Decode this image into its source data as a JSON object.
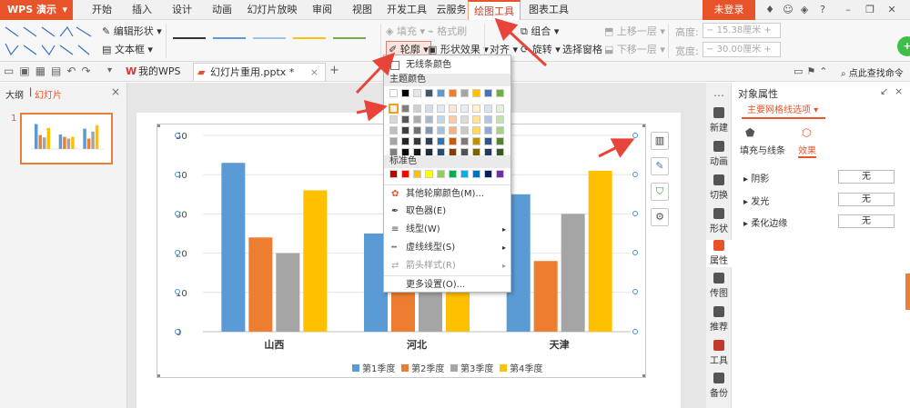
{
  "titlebar": {
    "app_name": "WPS 演示",
    "tabs": [
      "开始",
      "插入",
      "设计",
      "动画",
      "幻灯片放映",
      "审阅",
      "视图",
      "开发工具",
      "云服务",
      "绘图工具",
      "图表工具"
    ],
    "active_tab": "绘图工具",
    "login_label": "未登录",
    "icons": [
      "shirt-icon",
      "user-icon",
      "help-icon",
      "minimize-icon",
      "restore-icon",
      "close-icon"
    ]
  },
  "ribbon": {
    "edit_shape_label": "编辑形状",
    "textbox_label": "文本框",
    "fill_label": "填充",
    "format_brush_label": "格式刷",
    "outline_label": "轮廓",
    "shape_effect_label": "形状效果",
    "align_label": "对齐",
    "group_label": "组合",
    "rotate_label": "旋转",
    "selection_pane_label": "选择窗格",
    "bring_forward_label": "上移一层",
    "send_backward_label": "下移一层",
    "height_label": "高度:",
    "height_value": "15.38厘米",
    "width_label": "宽度:",
    "width_value": "30.00厘米",
    "line_style_colors": [
      "#333333",
      "#5b9bd5",
      "#9dc3e6",
      "#ffc000",
      "#70ad47"
    ]
  },
  "docbar": {
    "tabs": [
      {
        "label": "我的WPS"
      },
      {
        "label": "幻灯片重用.pptx *"
      }
    ],
    "search_label": "点此查找命令"
  },
  "leftpanel": {
    "tab_outline": "大纲",
    "tab_slides": "幻灯片",
    "slide_number": "1"
  },
  "dropdown": {
    "no_line_label": "无线条颜色",
    "theme_colors_header": "主题颜色",
    "standard_colors_header": "标准色",
    "theme_top_row": [
      "#ffffff",
      "#000000",
      "#e7e6e6",
      "#44546a",
      "#5b9bd5",
      "#ed7d31",
      "#a5a5a5",
      "#ffc000",
      "#4472c4",
      "#70ad47"
    ],
    "theme_shades": [
      [
        "#f2f2f2",
        "#7f7f7f",
        "#d0cece",
        "#d6dce4",
        "#deebf6",
        "#fbe5d5",
        "#ededed",
        "#fff2cc",
        "#d9e2f3",
        "#e2efd9"
      ],
      [
        "#d8d8d8",
        "#595959",
        "#aeabab",
        "#adb9ca",
        "#bdd7ee",
        "#f7cbac",
        "#dbdbdb",
        "#fee599",
        "#b4c6e7",
        "#c5e0b3"
      ],
      [
        "#bfbfbf",
        "#3f3f3f",
        "#757070",
        "#8496b0",
        "#9cc3e5",
        "#f4b183",
        "#c9c9c9",
        "#ffd965",
        "#8eaadb",
        "#a8d08d"
      ],
      [
        "#a5a5a5",
        "#262626",
        "#3a3838",
        "#323f4f",
        "#2e75b5",
        "#c55a11",
        "#7b7b7b",
        "#bf9000",
        "#2f5496",
        "#538135"
      ],
      [
        "#7f7f7f",
        "#0c0c0c",
        "#171616",
        "#222a35",
        "#1e4e79",
        "#833c0b",
        "#525252",
        "#7f6000",
        "#1f3864",
        "#375623"
      ]
    ],
    "standard_colors": [
      "#c00000",
      "#ff0000",
      "#ffc000",
      "#ffff00",
      "#92d050",
      "#00b050",
      "#00b0f0",
      "#0070c0",
      "#002060",
      "#7030a0"
    ],
    "more_colors_label": "其他轮廓颜色(M)...",
    "eyedropper_label": "取色器(E)",
    "line_type_label": "线型(W)",
    "dash_type_label": "虚线线型(S)",
    "arrow_style_label": "箭头样式(R)",
    "more_settings_label": "更多设置(O)..."
  },
  "rightpanel": {
    "title": "对象属性",
    "dropdown_label": "主要网格线选项",
    "tab_fill_line": "填充与线条",
    "tab_effects": "效果",
    "effects": [
      {
        "label": "阴影",
        "value": "无"
      },
      {
        "label": "发光",
        "value": "无"
      },
      {
        "label": "柔化边缘",
        "value": "无"
      }
    ],
    "sidebar": [
      "新建",
      "动画",
      "切换",
      "形状",
      "属性",
      "传图",
      "推荐",
      "工具",
      "备份"
    ]
  },
  "chart_data": {
    "type": "bar",
    "categories": [
      "山西",
      "河北",
      "天津"
    ],
    "series": [
      {
        "name": "第1季度",
        "color": "#5b9bd5",
        "values": [
          43,
          25,
          35
        ]
      },
      {
        "name": "第2季度",
        "color": "#ed7d31",
        "values": [
          24,
          21,
          18
        ]
      },
      {
        "name": "第3季度",
        "color": "#a5a5a5",
        "values": [
          20,
          18,
          30
        ]
      },
      {
        "name": "第4季度",
        "color": "#ffc000",
        "values": [
          36,
          21,
          41
        ]
      }
    ],
    "ylim": [
      0,
      50
    ],
    "yticks": [
      "0",
      "10",
      "20",
      "30",
      "40",
      "50"
    ],
    "grid": true,
    "legend_position": "bottom"
  }
}
